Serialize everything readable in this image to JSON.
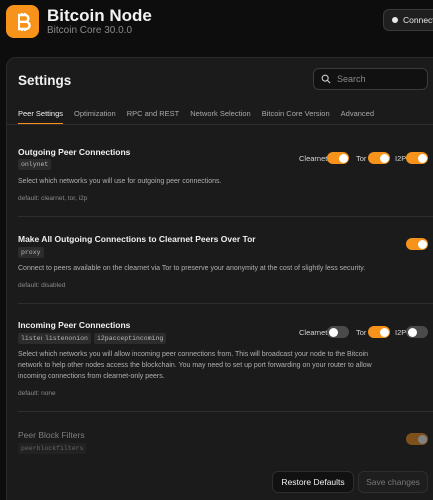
{
  "app": {
    "title": "Bitcoin Node",
    "subtitle": "Bitcoin Core 30.0.0",
    "connect_label": "Connect",
    "brand_color": "#f7931a"
  },
  "settings": {
    "title": "Settings",
    "search_placeholder": "Search"
  },
  "tabs": [
    {
      "label": "Peer Settings",
      "active": true
    },
    {
      "label": "Optimization",
      "active": false
    },
    {
      "label": "RPC and REST",
      "active": false
    },
    {
      "label": "Network Selection",
      "active": false
    },
    {
      "label": "Bitcoin Core Version",
      "active": false
    },
    {
      "label": "Advanced",
      "active": false
    }
  ],
  "sections": [
    {
      "title": "Outgoing Peer Connections",
      "chips": [
        "onlynet"
      ],
      "description": "Select which networks you will use for outgoing peer connections.",
      "default": "default: clearnet, tor, i2p",
      "toggles": [
        {
          "label": "Clearnet",
          "on": true
        },
        {
          "label": "Tor",
          "on": true
        },
        {
          "label": "I2P",
          "on": true
        }
      ]
    },
    {
      "title": "Make All Outgoing Connections to Clearnet Peers Over Tor",
      "chips": [
        "proxy"
      ],
      "description": "Connect to peers available on the clearnet via Tor to preserve your anonymity at the cost of slightly less security.",
      "default": "default: disabled",
      "toggle_on": true
    },
    {
      "title": "Incoming Peer Connections",
      "chips": [
        "listen",
        "listenonion",
        "i2pacceptincoming"
      ],
      "description_lines": [
        "Select which networks you will allow incoming peer connections from. This will broadcast your node to the Bitcoin",
        "network to help other nodes access the blockchain. You may need to set up port forwarding on your router to allow",
        "incoming connections from clearnet-only peers."
      ],
      "default": "default: none",
      "toggles": [
        {
          "label": "Clearnet",
          "on": false
        },
        {
          "label": "Tor",
          "on": true
        },
        {
          "label": "I2P",
          "on": false
        }
      ]
    },
    {
      "title": "Peer Block Filters",
      "chips": [
        "peerblockfilters"
      ],
      "toggle_on": true
    }
  ],
  "footer": {
    "restore_label": "Restore Defaults",
    "save_label": "Save changes"
  }
}
